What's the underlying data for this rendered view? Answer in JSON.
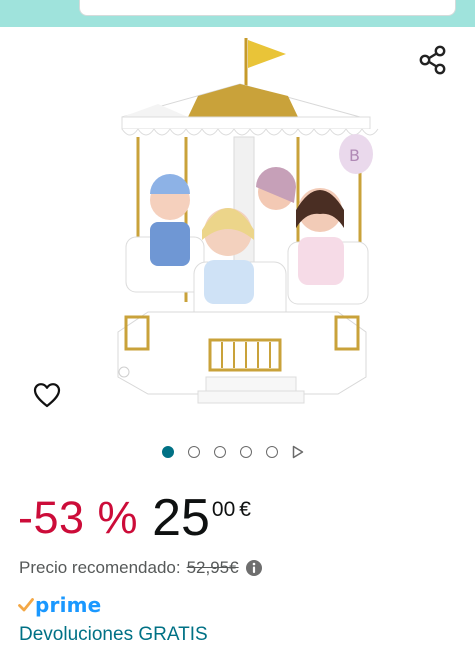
{
  "header": {
    "search_box_color": "#ffffff",
    "band_color": "#9fe3dc"
  },
  "actions": {
    "share_icon": "share-icon",
    "wishlist_icon": "heart-icon"
  },
  "product_image": {
    "description_icon": "carousel-dolls-image",
    "balloon_letter": "B"
  },
  "image_carousel": {
    "dot_count": 5,
    "active_index": 0,
    "play_icon": "play-triangle-icon"
  },
  "pricing": {
    "discount": "-53 %",
    "price_whole": "25",
    "price_fraction": "00",
    "currency": "€",
    "recommended_label": "Precio recomendado:",
    "recommended_price": "52,95€",
    "info_icon": "info-icon",
    "discount_color": "#cc0c39"
  },
  "delivery": {
    "prime_label": "prime",
    "prime_color": "#1a98ff",
    "returns_label": "Devoluciones GRATIS",
    "link_color": "#007185"
  }
}
